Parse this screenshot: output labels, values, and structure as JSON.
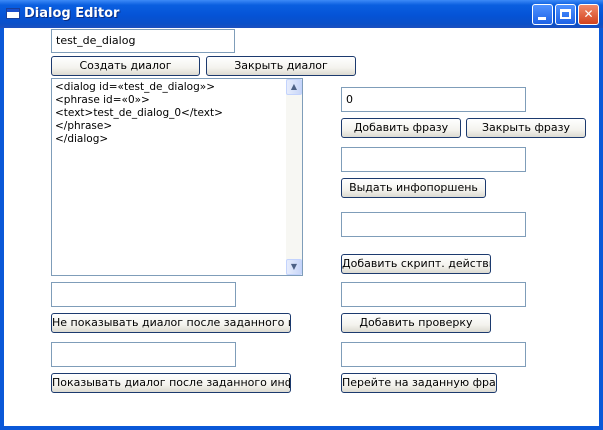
{
  "window": {
    "title": "Dialog Editor"
  },
  "dialog_name_input": {
    "value": "test_de_dialog"
  },
  "buttons": {
    "create_dialog": "Создать диалог",
    "close_dialog": "Закрыть диалог",
    "add_phrase": "Добавить фразу",
    "close_phrase": "Закрыть фразу",
    "give_infoportion": "Выдать инфопоршень",
    "add_script_action": "Добавить скрипт. действие",
    "add_check": "Добавить проверку",
    "goto_phrase": "Перейте на заданную фразу",
    "hide_after_info": "Не показывать диалог после заданного инфо",
    "show_after_info": "Показывать диалог после заданного инфо"
  },
  "xml_text": "<dialog id=«test_de_dialog»>\n<phrase id=«0»>\n<text>test_de_dialog_0</text>\n</phrase>\n</dialog>",
  "phrase_id_input": {
    "value": "0"
  },
  "infoportion_input": {
    "value": ""
  },
  "script_action_input": {
    "value": ""
  },
  "check_input": {
    "value": ""
  },
  "goto_phrase_input": {
    "value": ""
  },
  "hide_info_input": {
    "value": ""
  },
  "show_info_input": {
    "value": ""
  },
  "scrollbar": {
    "up_glyph": "▲",
    "down_glyph": "▼"
  }
}
